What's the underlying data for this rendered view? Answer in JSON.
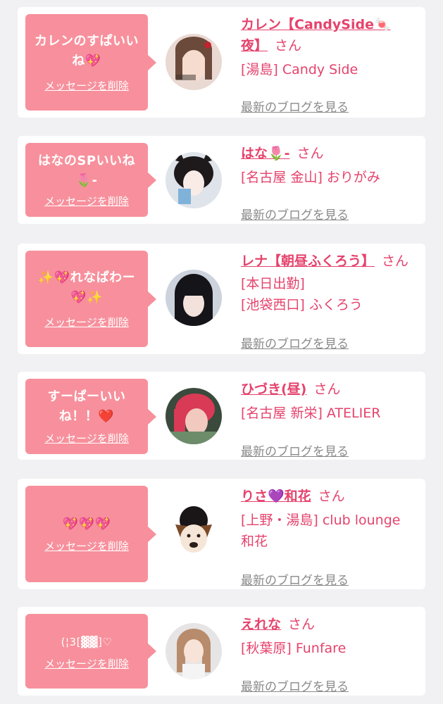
{
  "colors": {
    "bubble": "#f7909c",
    "accent": "#e5436c",
    "link_gray": "#8a8a8a",
    "background": "#f1f1f3"
  },
  "delete_label": "メッセージを削除",
  "san_label": "さん",
  "blog_label": "最新のブログを見る",
  "items": [
    {
      "message_lines": [
        "カレンのすぱいい",
        "ね💖"
      ],
      "name": "カレン【CandySide🍬夜】",
      "shop_lines": [
        "[湯島] Candy Side"
      ]
    },
    {
      "message_lines": [
        "はなのSPいいね",
        "🌷-"
      ],
      "name": "はな🌷-",
      "shop_lines": [
        "[名古屋 金山] おりがみ"
      ]
    },
    {
      "message_lines": [
        "✨💖れなぱわー",
        "💖✨"
      ],
      "name": "レナ【朝昼ふくろう】",
      "shop_lines": [
        "[本日出勤]",
        "[池袋西口] ふくろう"
      ]
    },
    {
      "message_lines": [
        "すーぱーいい",
        "ね！！❤️"
      ],
      "name": "ひづき(昼)",
      "shop_lines": [
        "[名古屋 新栄] ATELIER"
      ]
    },
    {
      "message_lines": [
        "💖💖💖"
      ],
      "name": "りさ💜和花",
      "shop_lines": [
        "[上野・湯島] club lounge",
        "和花"
      ]
    },
    {
      "message_lines": [
        "(¦3[▓▓]♡"
      ],
      "name": "えれな",
      "shop_lines": [
        "[秋葉原] Funfare"
      ]
    }
  ]
}
